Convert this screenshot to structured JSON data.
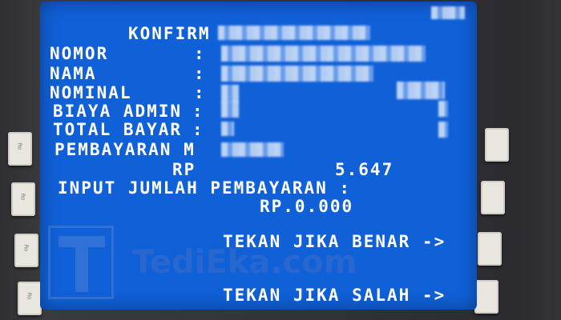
{
  "screen": {
    "title": "KONFIRM",
    "fields": [
      {
        "label": "NOMOR",
        "sep": ":"
      },
      {
        "label": "NAMA",
        "sep": ":"
      },
      {
        "label": "NOMINAL",
        "sep": ":"
      },
      {
        "label": "BIAYA ADMIN",
        "sep": ":"
      },
      {
        "label": "TOTAL BAYAR",
        "sep": ":"
      },
      {
        "label": "PEMBAYARAN M"
      }
    ],
    "amount_currency": "RP",
    "amount_value": "5.647",
    "input_prompt": "INPUT JUMLAH PEMBAYARAN :",
    "input_value": "RP.0.000",
    "option_correct": "TEKAN JIKA BENAR ->",
    "option_wrong": "TEKAN JIKA SALAH ->"
  },
  "watermark": {
    "text": "TediEka.com"
  },
  "colors": {
    "screen_bg": "#1060d8",
    "text": "#ffffff"
  }
}
